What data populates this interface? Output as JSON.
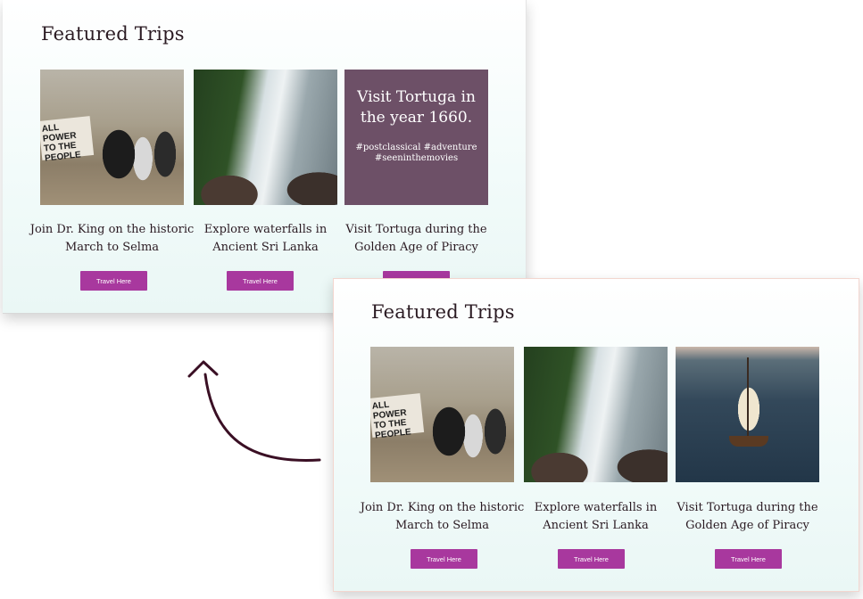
{
  "back_card": {
    "title": "Featured Trips",
    "tiles": [
      {
        "caption": "Join Dr. King on the historic March to Selma",
        "button": "Travel Here",
        "sign_text": "ALL POWER TO THE PEOPLE"
      },
      {
        "caption": "Explore waterfalls in Ancient Sri Lanka",
        "button": "Travel Here"
      },
      {
        "caption": "Visit Tortuga during the Golden Age of Piracy",
        "button": "Travel Here",
        "promo_headline": "Visit Tortuga in the year 1660.",
        "promo_tags": "#postclassical #adventure #seeninthemovies"
      }
    ]
  },
  "front_card": {
    "title": "Featured Trips",
    "tiles": [
      {
        "caption": "Join Dr. King on the historic March to Selma",
        "button": "Travel Here",
        "sign_text": "ALL POWER TO THE PEOPLE"
      },
      {
        "caption": "Explore waterfalls in Ancient Sri Lanka",
        "button": "Travel Here"
      },
      {
        "caption": "Visit Tortuga during the Golden Age of Piracy",
        "button": "Travel Here"
      }
    ]
  },
  "colors": {
    "button": "#a8389e",
    "promo_tile": "#6d5067",
    "title_text": "#2a1a22",
    "arrow": "#3a0f24"
  },
  "icons": [
    "curved-arrow-icon"
  ]
}
